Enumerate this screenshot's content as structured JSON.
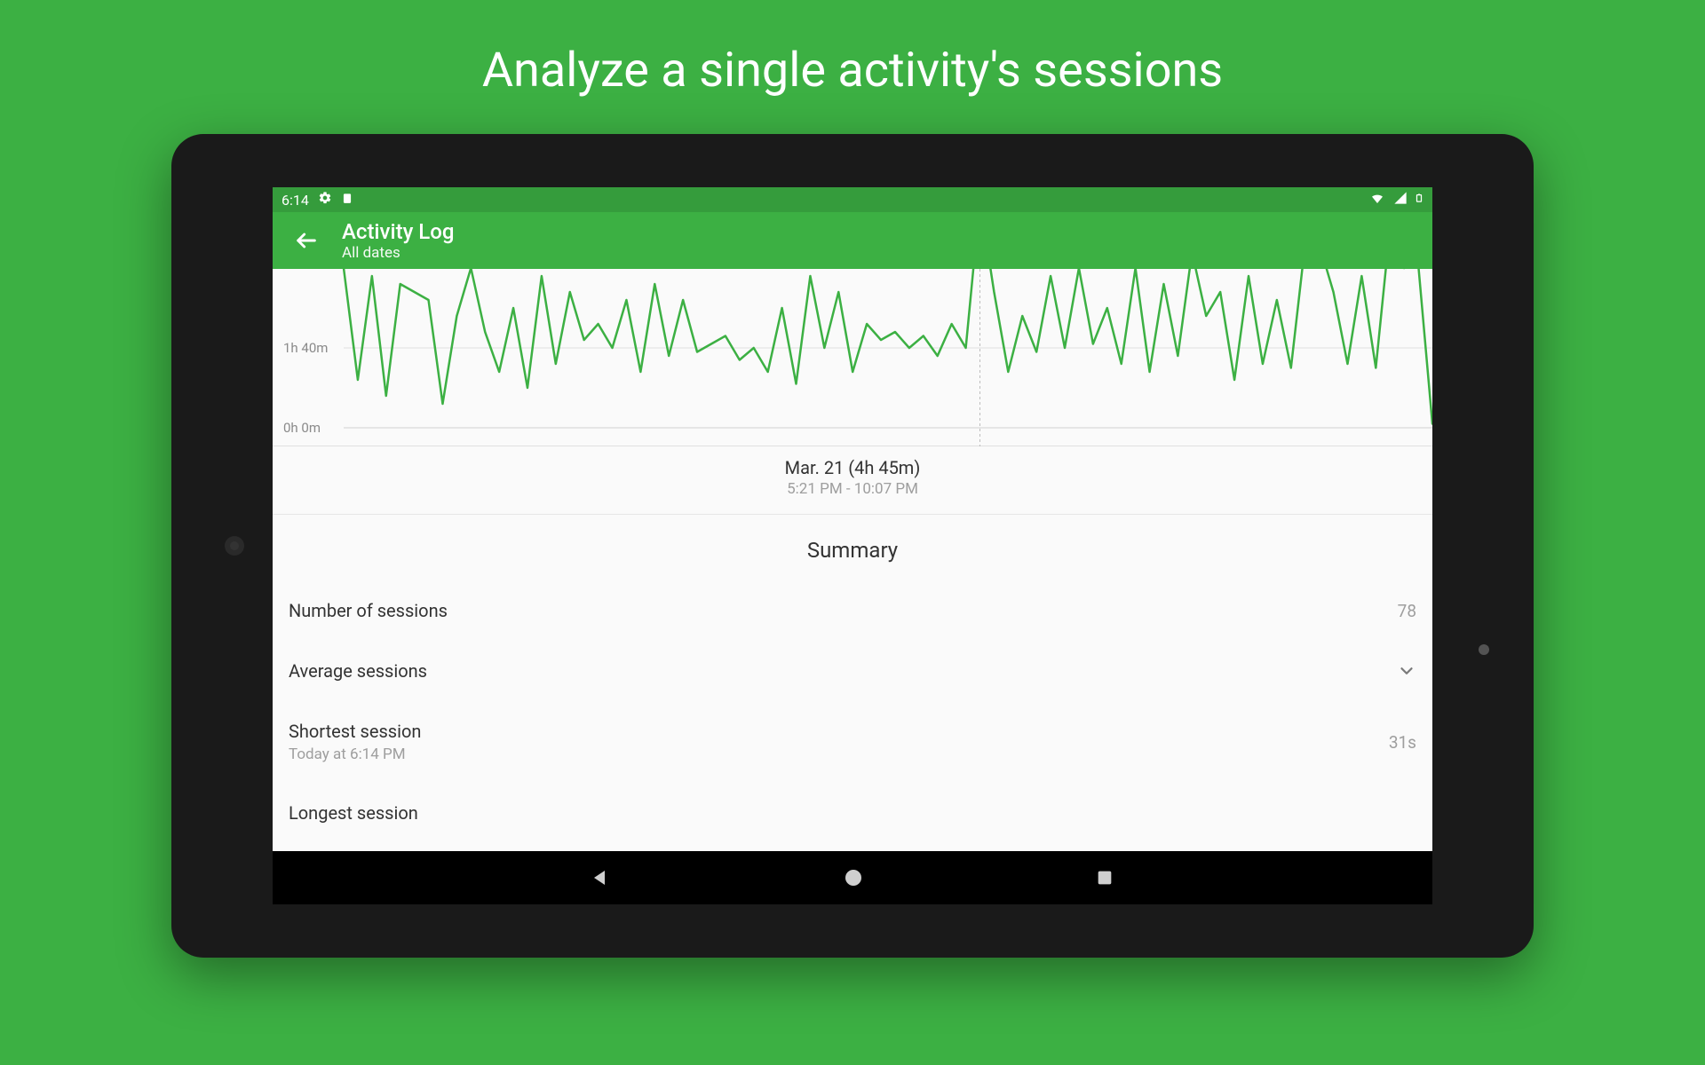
{
  "headline": "Analyze a single activity's sessions",
  "status_bar": {
    "time": "6:14",
    "wifi_icon": "wifi",
    "signal_icon": "signal",
    "battery_icon": "battery"
  },
  "app_bar": {
    "title": "Activity Log",
    "subtitle": "All dates"
  },
  "chart_data": {
    "type": "line",
    "title": "",
    "xlabel": "",
    "ylabel": "",
    "yticks": [
      "1h 40m",
      "0h 0m"
    ],
    "ylim_minutes": [
      0,
      200
    ],
    "selected_index": 45,
    "x": [
      0,
      1,
      2,
      3,
      4,
      5,
      6,
      7,
      8,
      9,
      10,
      11,
      12,
      13,
      14,
      15,
      16,
      17,
      18,
      19,
      20,
      21,
      22,
      23,
      24,
      25,
      26,
      27,
      28,
      29,
      30,
      31,
      32,
      33,
      34,
      35,
      36,
      37,
      38,
      39,
      40,
      41,
      42,
      43,
      44,
      45,
      46,
      47,
      48,
      49,
      50,
      51,
      52,
      53,
      54,
      55,
      56,
      57,
      58,
      59,
      60,
      61,
      62,
      63,
      64,
      65,
      66,
      67,
      68,
      69,
      70,
      71,
      72,
      73,
      74,
      75,
      76,
      77
    ],
    "values_minutes": [
      200,
      60,
      190,
      40,
      180,
      170,
      160,
      30,
      140,
      200,
      120,
      70,
      150,
      50,
      190,
      80,
      170,
      110,
      130,
      100,
      160,
      70,
      180,
      90,
      160,
      95,
      105,
      115,
      85,
      100,
      70,
      150,
      55,
      190,
      100,
      170,
      70,
      130,
      110,
      120,
      100,
      115,
      90,
      130,
      100,
      285,
      170,
      70,
      140,
      95,
      190,
      100,
      200,
      105,
      150,
      80,
      200,
      70,
      180,
      90,
      220,
      140,
      170,
      60,
      190,
      80,
      160,
      75,
      230,
      230,
      170,
      80,
      190,
      75,
      250,
      200,
      205,
      5
    ],
    "caption": {
      "line1": "Mar. 21 (4h 45m)",
      "line2": "5:21 PM - 10:07 PM"
    }
  },
  "summary": {
    "title": "Summary",
    "rows": [
      {
        "label": "Number of sessions",
        "value": "78"
      },
      {
        "label": "Average sessions",
        "expandable": true
      },
      {
        "label": "Shortest session",
        "sub": "Today at 6:14 PM",
        "value": "31s"
      },
      {
        "label": "Longest session"
      }
    ]
  }
}
